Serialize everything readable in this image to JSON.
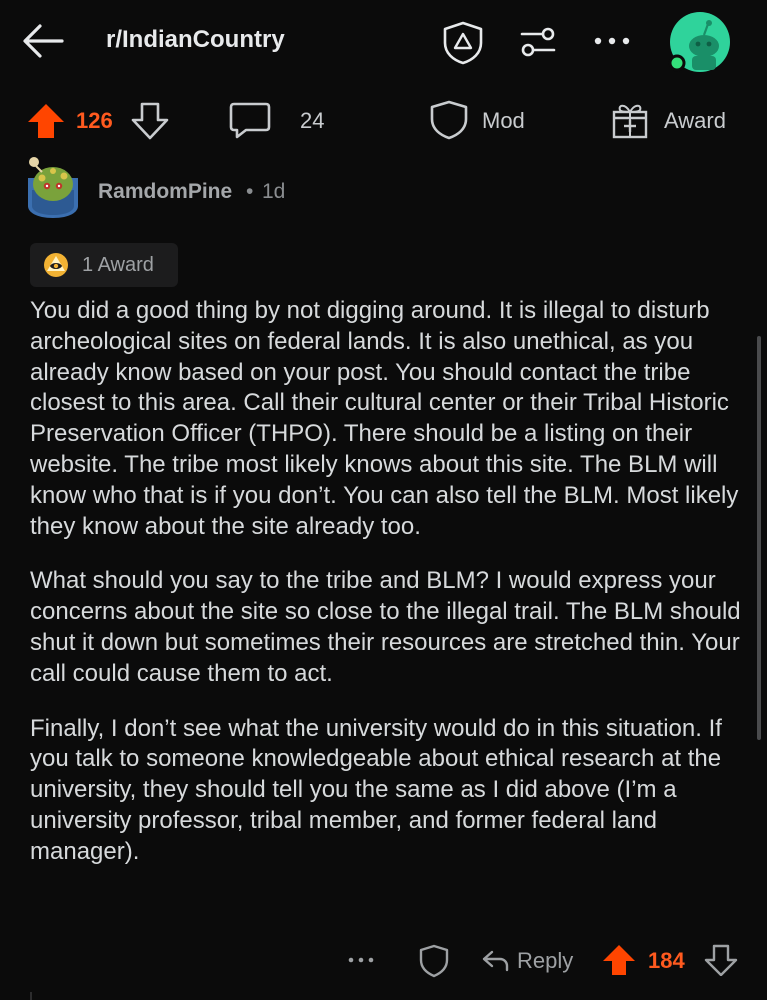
{
  "header": {
    "subreddit": "r/IndianCountry"
  },
  "post_actions": {
    "vote_count": "126",
    "comment_count": "24",
    "mod_label": "Mod",
    "award_label": "Award"
  },
  "comment": {
    "username": "RamdomPine",
    "separator": "•",
    "age": "1d",
    "award_badge": "1 Award",
    "paragraphs": [
      "You did a good thing by not digging around. It is illegal to disturb archeological sites on federal lands. It is also unethical, as you already know based on your post. You should contact the tribe closest to this area. Call their cultural center or their Tribal Historic Preservation Officer (THPO). There should be a listing on their website. The tribe most likely knows about this site. The BLM will know who that is if you don’t. You can also tell the BLM. Most likely they know about the site already too.",
      "What should you say to the tribe and BLM? I would express your concerns about the site so close to the illegal trail. The BLM should shut it down but sometimes their resources are stretched thin. Your call could cause them to act.",
      "Finally, I don’t see what the university would do in this situation. If you talk to someone knowledgeable about ethical research at the university, they should tell you the same as I did above (I’m a university professor, tribal member, and former federal land manager)."
    ],
    "reply_label": "Reply",
    "vote_count": "184"
  },
  "colors": {
    "background": "#0b0b0b",
    "upvote_orange": "#ff4500",
    "text": "#d7dadc",
    "muted": "#8a8d90",
    "avatar_green": "#2fd39b"
  },
  "icons": {
    "back": "back-arrow-icon",
    "shield": "shield-icon",
    "sliders": "sliders-icon",
    "more": "more-dots-icon",
    "upvote": "upvote-arrow-icon",
    "downvote": "downvote-arrow-icon",
    "comment": "comment-bubble-icon",
    "award": "gift-award-icon",
    "reply": "reply-arrow-icon"
  }
}
